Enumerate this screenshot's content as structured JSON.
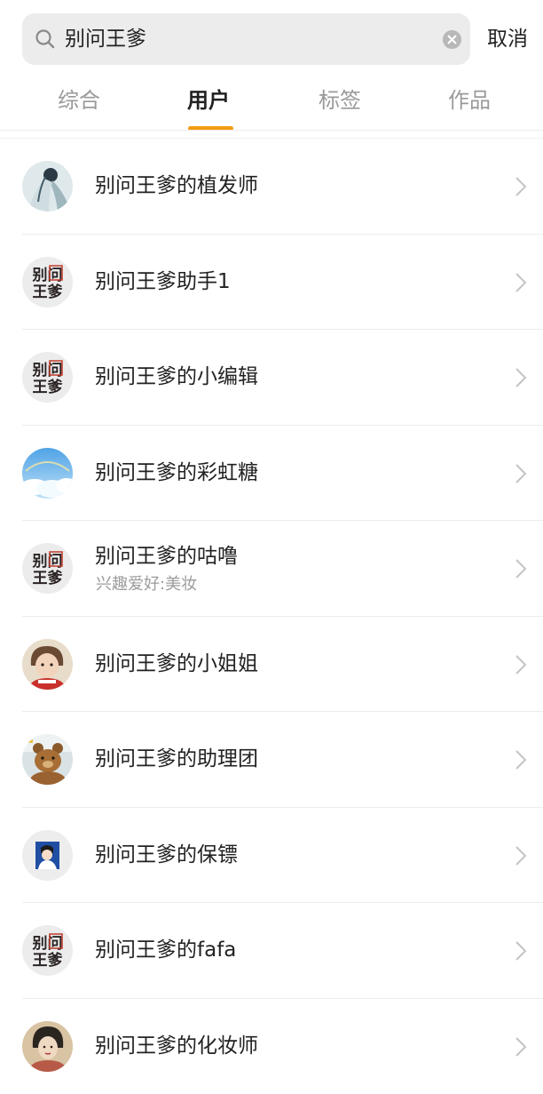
{
  "search": {
    "query": "别问王爹",
    "cancel_label": "取消"
  },
  "tabs": [
    {
      "label": "综合",
      "active": false
    },
    {
      "label": "用户",
      "active": true
    },
    {
      "label": "标签",
      "active": false
    },
    {
      "label": "作品",
      "active": false
    }
  ],
  "colors": {
    "accent": "#f39c12",
    "text_primary": "#222222",
    "text_secondary": "#9c9c9c",
    "search_bg": "#ececec",
    "divider": "#ececec"
  },
  "users": [
    {
      "name": "别问王爹的植发师",
      "subtitle": "",
      "avatar": "anime-girl-avatar"
    },
    {
      "name": "别问王爹助手1",
      "subtitle": "",
      "avatar": "logo-avatar"
    },
    {
      "name": "别问王爹的小编辑",
      "subtitle": "",
      "avatar": "logo-avatar"
    },
    {
      "name": "别问王爹的彩虹糖",
      "subtitle": "",
      "avatar": "sky-rainbow-avatar"
    },
    {
      "name": "别问王爹的咕噜",
      "subtitle": "兴趣爱好:美妆",
      "avatar": "logo-avatar"
    },
    {
      "name": "别问王爹的小姐姐",
      "subtitle": "",
      "avatar": "child-photo-avatar"
    },
    {
      "name": "别问王爹的助理团",
      "subtitle": "",
      "avatar": "teddy-bear-avatar"
    },
    {
      "name": "别问王爹的保镖",
      "subtitle": "",
      "avatar": "cartoon-boy-avatar"
    },
    {
      "name": "别问王爹的fafa",
      "subtitle": "",
      "avatar": "logo-avatar"
    },
    {
      "name": "别问王爹的化妆师",
      "subtitle": "",
      "avatar": "painting-avatar"
    }
  ],
  "logo_avatar_text": [
    "别问",
    "王爹"
  ]
}
